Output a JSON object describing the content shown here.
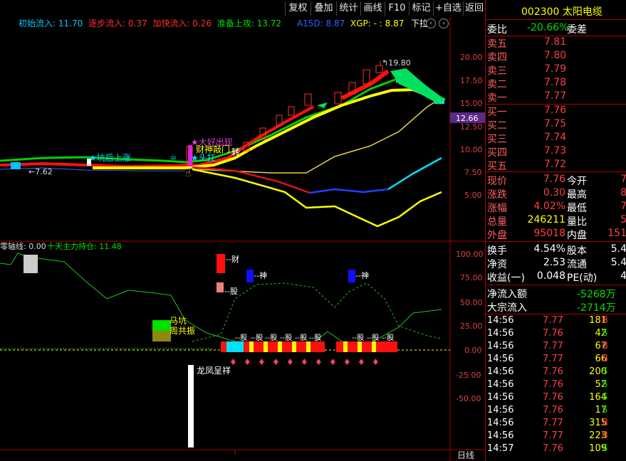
{
  "toolbar": {
    "buttons": [
      "复权",
      "叠加",
      "统计",
      "画线",
      "F10",
      "标记",
      "+自选",
      "返回"
    ]
  },
  "indicator_title": {
    "items": [
      {
        "text": "初始流入: 11.70",
        "color": "#00c8ff"
      },
      {
        "text": "逐步流入: 0.37",
        "color": "#ff3030"
      },
      {
        "text": "加快流入: 0.26",
        "color": "#ff3030"
      },
      {
        "text": "准备上攻: 13.72",
        "color": "#00e000"
      },
      {
        "text": "A15D: 8.87",
        "color": "#3060ff"
      },
      {
        "text": "XGP: - : 8.87",
        "color": "#ffff00"
      }
    ],
    "dropdown_label": "下拉"
  },
  "main_axis": {
    "labels": [
      "20.00",
      "17.50",
      "15.00",
      "12.50",
      "10.00",
      "7.50",
      "5.00"
    ],
    "current_price_tag": "12.66",
    "high_label": "19.80",
    "low_label": "7.62"
  },
  "main_annotations": {
    "pit_rise": "坑后上涨",
    "big_opportunity": "大好出现",
    "wealth_door": "财神敲门",
    "head_shoulder": "头扛",
    "turn_around": "转"
  },
  "sub_title": {
    "zero_axis": "零轴线: 0.00",
    "ten_day": "十天主力持仓: 11.48"
  },
  "sub_axis": {
    "labels": [
      "100.00",
      "75.00",
      "50.00",
      "25.00",
      "0.00",
      "-25.00",
      "-50.00"
    ]
  },
  "sub_annotations": {
    "cai": "财",
    "shen1": "神",
    "shen2": "神",
    "ma_keng": "马坑",
    "zhou_gong": "周共振",
    "long_feng": "龙凤呈祥",
    "small_tag": "--股"
  },
  "bottom_tab": "日线",
  "quote": {
    "code": "002300",
    "name": "太阳电缆",
    "weibi_label": "委比",
    "weibi_value": "-20.66%",
    "weicha_label": "委差",
    "asks": [
      {
        "label": "卖五",
        "price": "7.81"
      },
      {
        "label": "卖四",
        "price": "7.80"
      },
      {
        "label": "卖三",
        "price": "7.79"
      },
      {
        "label": "卖二",
        "price": "7.78"
      },
      {
        "label": "卖一",
        "price": "7.77"
      }
    ],
    "bids": [
      {
        "label": "买一",
        "price": "7.76"
      },
      {
        "label": "买二",
        "price": "7.75"
      },
      {
        "label": "买三",
        "price": "7.74"
      },
      {
        "label": "买四",
        "price": "7.73"
      },
      {
        "label": "买五",
        "price": "7.72"
      }
    ],
    "stats": [
      {
        "l1": "现价",
        "v1": "7.76",
        "c1": "red",
        "l2": "今开",
        "v2": "7"
      },
      {
        "l1": "涨跌",
        "v1": "0.30",
        "c1": "red",
        "l2": "最高",
        "v2": "8"
      },
      {
        "l1": "涨幅",
        "v1": "4.02%",
        "c1": "red",
        "l2": "最低",
        "v2": "7"
      },
      {
        "l1": "总量",
        "v1": "246211",
        "c1": "yel",
        "l2": "量比",
        "v2": "5"
      },
      {
        "l1": "外盘",
        "v1": "95018",
        "c1": "red",
        "l2": "内盘",
        "v2": "151"
      }
    ],
    "stats2": [
      {
        "l1": "换手",
        "v1": "4.54%",
        "l2": "股本",
        "v2": "5.4"
      },
      {
        "l1": "净资",
        "v1": "2.53",
        "l2": "流通",
        "v2": "5.4"
      },
      {
        "l1": "收益(一)",
        "v1": "0.048",
        "l2": "PE(动)",
        "v2": "4"
      }
    ],
    "net_inflow_label": "净流入额",
    "net_inflow_value": "-5268万",
    "block_inflow_label": "大宗流入",
    "block_inflow_value": "-2714万",
    "trades": [
      {
        "time": "14:56",
        "price": "7.77",
        "vol": "181",
        "side": "B"
      },
      {
        "time": "14:56",
        "price": "7.76",
        "vol": "42",
        "side": "S"
      },
      {
        "time": "14:56",
        "price": "7.77",
        "vol": "67",
        "side": "B"
      },
      {
        "time": "14:56",
        "price": "7.77",
        "vol": "66",
        "side": "B"
      },
      {
        "time": "14:56",
        "price": "7.76",
        "vol": "200",
        "side": "S"
      },
      {
        "time": "14:56",
        "price": "7.76",
        "vol": "52",
        "side": "S"
      },
      {
        "time": "14:56",
        "price": "7.76",
        "vol": "164",
        "side": "S"
      },
      {
        "time": "14:56",
        "price": "7.76",
        "vol": "17",
        "side": "S"
      },
      {
        "time": "14:56",
        "price": "7.77",
        "vol": "315",
        "side": "B"
      },
      {
        "time": "14:56",
        "price": "7.77",
        "vol": "223",
        "side": "B"
      },
      {
        "time": "14:57",
        "price": "7.76",
        "vol": "109",
        "side": "S"
      }
    ]
  }
}
